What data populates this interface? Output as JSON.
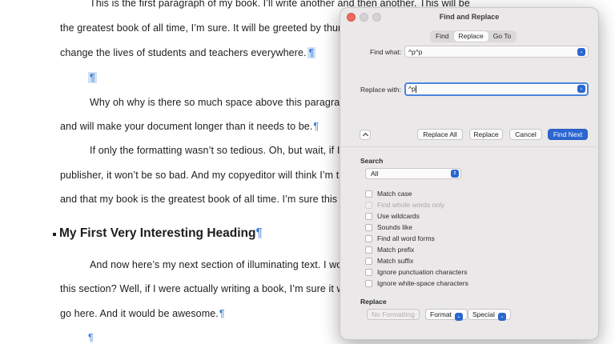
{
  "document": {
    "lines": [
      "This is the first paragraph of my book. I’ll write another and then another. This will be",
      "the greatest book of all time, I’m sure. It will be greeted by thunderous applause and",
      "change the lives of students and teachers everywhere.",
      "",
      "Why oh why is there so much space above this paragraph? It’s not there on purpose",
      "and will make your document longer than it needs to be.",
      "If only the formatting wasn’t so tedious. Oh, but wait, if I follow the advice of my",
      "publisher, it won’t be so bad. And my copyeditor will think I’m the greatest, too,",
      "and that my book is the greatest book of all time. I’m sure this will happen.",
      "And now here’s my next section of illuminating text. I wonder what I’ll put in",
      "this section? Well, if I were actually writing a book, I’m sure it would be something good to",
      "go here. And it would be awesome."
    ],
    "pilcrow": "¶",
    "heading": "My First Very Interesting Heading"
  },
  "dialog": {
    "title": "Find and Replace",
    "tabs": [
      "Find",
      "Replace",
      "Go To"
    ],
    "active_tab": "Replace",
    "find_label": "Find what:",
    "find_value": "^p^p",
    "replace_label": "Replace with:",
    "replace_value": "^p",
    "buttons": {
      "replace_all": "Replace All",
      "replace": "Replace",
      "cancel": "Cancel",
      "find_next": "Find Next"
    },
    "search_header": "Search",
    "search_scope": "All",
    "options": [
      {
        "label": "Match case",
        "enabled": true,
        "checked": false
      },
      {
        "label": "Find whole words only",
        "enabled": false,
        "checked": false
      },
      {
        "label": "Use wildcards",
        "enabled": true,
        "checked": false
      },
      {
        "label": "Sounds like",
        "enabled": true,
        "checked": false
      },
      {
        "label": "Find all word forms",
        "enabled": true,
        "checked": false
      },
      {
        "label": "Match prefix",
        "enabled": true,
        "checked": false
      },
      {
        "label": "Match suffix",
        "enabled": true,
        "checked": false
      },
      {
        "label": "Ignore punctuation characters",
        "enabled": true,
        "checked": false
      },
      {
        "label": "Ignore white-space characters",
        "enabled": true,
        "checked": false
      }
    ],
    "replace_header": "Replace",
    "no_formatting": "No Formatting",
    "format": "Format",
    "special": "Special"
  },
  "colors": {
    "accent": "#2c66d0",
    "pilcrow": "#3a7bd5",
    "close": "#ee6a5e"
  }
}
